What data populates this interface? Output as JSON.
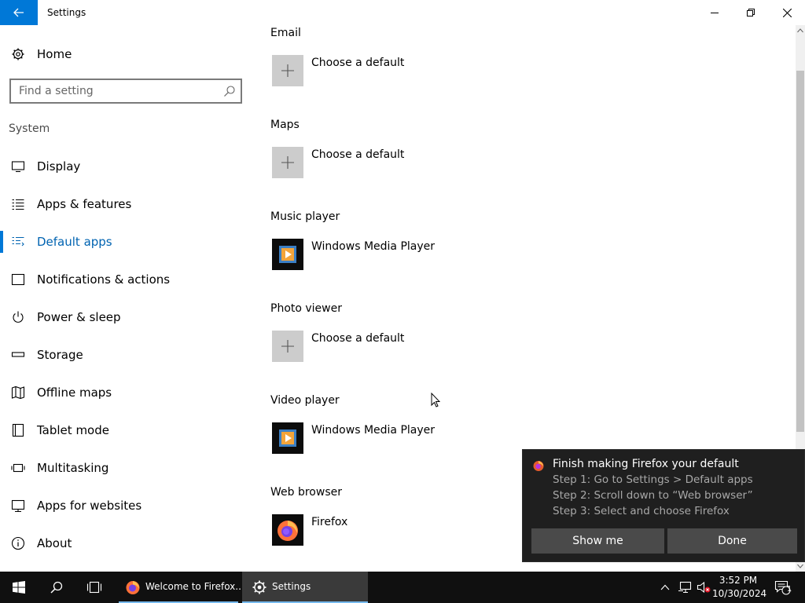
{
  "window": {
    "title": "Settings",
    "buttons": {
      "back": "arrow-left-icon",
      "minimize": "minimize-icon",
      "restore": "restore-icon",
      "close": "close-icon"
    }
  },
  "sidebar": {
    "home": {
      "label": "Home",
      "icon": "gear-icon"
    },
    "search": {
      "placeholder": "Find a setting",
      "icon": "search-icon"
    },
    "section": "System",
    "items": [
      {
        "label": "Display",
        "icon": "monitor-icon",
        "active": false
      },
      {
        "label": "Apps & features",
        "icon": "list-icon",
        "active": false
      },
      {
        "label": "Default apps",
        "icon": "default-apps-icon",
        "active": true
      },
      {
        "label": "Notifications & actions",
        "icon": "notification-icon",
        "active": false
      },
      {
        "label": "Power & sleep",
        "icon": "power-icon",
        "active": false
      },
      {
        "label": "Storage",
        "icon": "storage-icon",
        "active": false
      },
      {
        "label": "Offline maps",
        "icon": "map-icon",
        "active": false
      },
      {
        "label": "Tablet mode",
        "icon": "tablet-icon",
        "active": false
      },
      {
        "label": "Multitasking",
        "icon": "multitasking-icon",
        "active": false
      },
      {
        "label": "Apps for websites",
        "icon": "apps-websites-icon",
        "active": false
      },
      {
        "label": "About",
        "icon": "info-icon",
        "active": false
      }
    ]
  },
  "main": {
    "categories": [
      {
        "title": "Email",
        "app": "Choose a default",
        "app_icon": "plus-icon"
      },
      {
        "title": "Maps",
        "app": "Choose a default",
        "app_icon": "plus-icon"
      },
      {
        "title": "Music player",
        "app": "Windows Media Player",
        "app_icon": "windows-media-player-icon"
      },
      {
        "title": "Photo viewer",
        "app": "Choose a default",
        "app_icon": "plus-icon"
      },
      {
        "title": "Video player",
        "app": "Windows Media Player",
        "app_icon": "windows-media-player-icon"
      },
      {
        "title": "Web browser",
        "app": "Firefox",
        "app_icon": "firefox-icon"
      }
    ]
  },
  "toast": {
    "icon": "firefox-icon",
    "title": "Finish making Firefox your default",
    "lines": [
      "Step 1: Go to Settings > Default apps",
      "Step 2: Scroll down to “Web browser”",
      "Step 3: Select and choose Firefox"
    ],
    "buttons": {
      "primary": "Show me",
      "secondary": "Done"
    }
  },
  "taskbar": {
    "start_icon": "windows-start-icon",
    "search_icon": "search-icon",
    "task_view_icon": "task-view-icon",
    "apps": [
      {
        "label": "Welcome to Firefox...",
        "icon": "firefox-icon",
        "active": false
      },
      {
        "label": "Settings",
        "icon": "gear-icon",
        "active": true
      }
    ],
    "tray": {
      "icons": [
        "chevron-up-icon",
        "network-icon",
        "volume-muted-icon"
      ],
      "time": "3:52 PM",
      "date": "10/30/2024",
      "notification_count": "1"
    }
  },
  "colors": {
    "accent": "#0078d7",
    "active_text": "#0063b1",
    "tile_gray": "#cccccc",
    "toast_bg": "#1f1f1f",
    "taskbar_bg": "#101010"
  }
}
